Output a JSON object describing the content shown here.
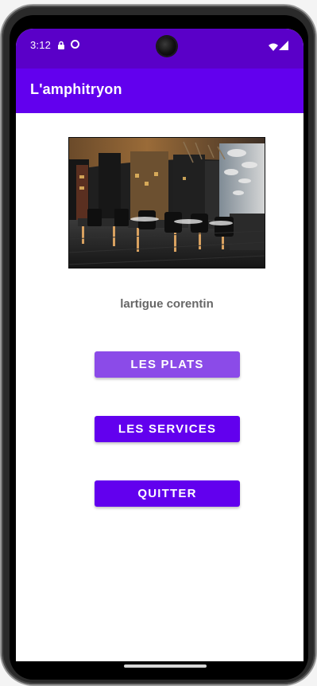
{
  "status_bar": {
    "time": "3:12",
    "icons": [
      "lock-icon",
      "circle-icon",
      "wifi-icon",
      "signal-icon"
    ]
  },
  "app_bar": {
    "title": "L'amphitryon"
  },
  "content": {
    "image_icon": "restaurant-photo",
    "user_name": "lartigue corentin",
    "buttons": {
      "plats": "LES PLATS",
      "services": "LES SERVICES",
      "quitter": "QUITTER"
    }
  },
  "colors": {
    "status_bar": "#5a00c8",
    "app_bar": "#6200ee",
    "button_primary": "#6200ee",
    "button_highlight": "#8b4be8",
    "username_text": "#676767"
  }
}
